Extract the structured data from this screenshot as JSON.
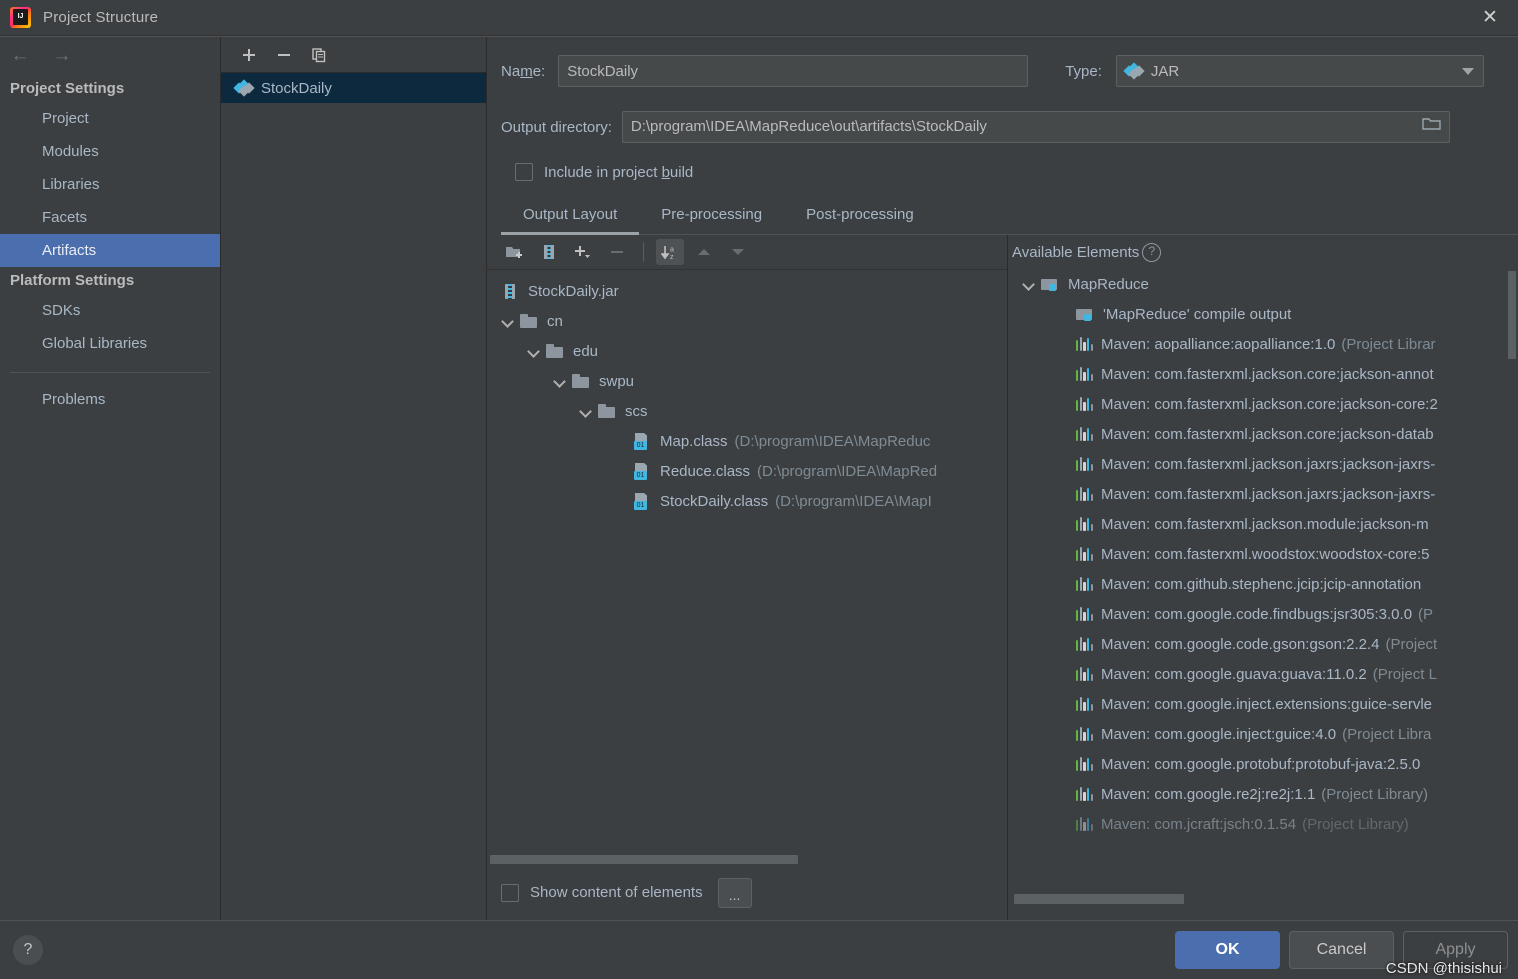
{
  "window": {
    "title": "Project Structure",
    "app_icon": "intellij-idea-logo",
    "close_label": "✕"
  },
  "sidebar": {
    "back_label": "←",
    "forward_label": "→",
    "groups": [
      {
        "title": "Project Settings",
        "items": [
          {
            "label": "Project",
            "selected": false
          },
          {
            "label": "Modules",
            "selected": false
          },
          {
            "label": "Libraries",
            "selected": false
          },
          {
            "label": "Facets",
            "selected": false
          },
          {
            "label": "Artifacts",
            "selected": true
          }
        ]
      },
      {
        "title": "Platform Settings",
        "items": [
          {
            "label": "SDKs",
            "selected": false
          },
          {
            "label": "Global Libraries",
            "selected": false
          }
        ]
      }
    ],
    "problems_label": "Problems"
  },
  "artifacts_panel": {
    "toolbar": [
      {
        "name": "add-artifact-button",
        "glyph": "+"
      },
      {
        "name": "remove-artifact-button",
        "glyph": "−"
      },
      {
        "name": "copy-artifact-button",
        "glyph": "⧉"
      }
    ],
    "items": [
      {
        "label": "StockDaily",
        "selected": true,
        "icon": "artifact-diamond-icon"
      }
    ]
  },
  "editor": {
    "name_label": "Na",
    "name_label_accel": "m",
    "name_label_rest": "e:",
    "name_value": "StockDaily",
    "type_label": "Type:",
    "type_value": "JAR",
    "output_dir_label": "Output directory:",
    "output_dir_value": "D:\\program\\IDEA\\MapReduce\\out\\artifacts\\StockDaily",
    "include_in_build_pre": "Include in project ",
    "include_in_build_accel": "b",
    "include_in_build_post": "uild",
    "include_in_build_checked": false,
    "tabs": [
      {
        "label": "Output Layout",
        "active": true
      },
      {
        "label": "Pre-processing",
        "active": false
      },
      {
        "label": "Post-processing",
        "active": false
      }
    ]
  },
  "output_layout": {
    "toolbar": [
      {
        "name": "add-directory-button",
        "glyph": "folder-plus-icon",
        "state": "enabled"
      },
      {
        "name": "add-archive-button",
        "glyph": "archive-icon",
        "state": "enabled"
      },
      {
        "name": "add-element-button",
        "glyph": "plus-dropdown-icon",
        "state": "enabled"
      },
      {
        "name": "remove-element-button",
        "glyph": "minus-icon",
        "state": "disabled"
      },
      {
        "name": "sort-alphabetically-button",
        "glyph": "sort-az-icon",
        "state": "toggled"
      },
      {
        "name": "move-up-button",
        "glyph": "arrow-up-icon",
        "state": "disabled"
      },
      {
        "name": "move-down-button",
        "glyph": "arrow-down-icon",
        "state": "disabled"
      }
    ],
    "tree": [
      {
        "label": "StockDaily.jar",
        "indent": 0,
        "icon": "jar",
        "chevron": false,
        "path": ""
      },
      {
        "label": "cn",
        "indent": 0,
        "icon": "folder",
        "chevron": true,
        "path": ""
      },
      {
        "label": "edu",
        "indent": 1,
        "icon": "folder",
        "chevron": true,
        "path": ""
      },
      {
        "label": "swpu",
        "indent": 2,
        "icon": "folder",
        "chevron": true,
        "path": ""
      },
      {
        "label": "scs",
        "indent": 3,
        "icon": "folder",
        "chevron": true,
        "path": ""
      },
      {
        "label": "Map.class",
        "indent": 4,
        "icon": "clazz",
        "chevron": false,
        "path": "(D:\\program\\IDEA\\MapReduc"
      },
      {
        "label": "Reduce.class",
        "indent": 4,
        "icon": "clazz",
        "chevron": false,
        "path": "(D:\\program\\IDEA\\MapRed"
      },
      {
        "label": "StockDaily.class",
        "indent": 4,
        "icon": "clazz",
        "chevron": false,
        "path": "(D:\\program\\IDEA\\MapI"
      }
    ],
    "show_content_label": "Show content of elements",
    "show_content_checked": false,
    "more_button_label": "..."
  },
  "available_elements": {
    "title": "Available Elements",
    "help_glyph": "?",
    "items": [
      {
        "label": "MapReduce",
        "indent": 0,
        "icon": "modfolder",
        "chevron": true,
        "sub": ""
      },
      {
        "label": "'MapReduce' compile output",
        "indent": 1,
        "icon": "modfolder",
        "chevron": false,
        "sub": ""
      },
      {
        "label": "Maven: aopalliance:aopalliance:1.0",
        "indent": 1,
        "icon": "library",
        "chevron": false,
        "sub": "(Project Librar"
      },
      {
        "label": "Maven: com.fasterxml.jackson.core:jackson-annot",
        "indent": 1,
        "icon": "library",
        "chevron": false,
        "sub": ""
      },
      {
        "label": "Maven: com.fasterxml.jackson.core:jackson-core:2",
        "indent": 1,
        "icon": "library",
        "chevron": false,
        "sub": ""
      },
      {
        "label": "Maven: com.fasterxml.jackson.core:jackson-datab",
        "indent": 1,
        "icon": "library",
        "chevron": false,
        "sub": ""
      },
      {
        "label": "Maven: com.fasterxml.jackson.jaxrs:jackson-jaxrs-",
        "indent": 1,
        "icon": "library",
        "chevron": false,
        "sub": ""
      },
      {
        "label": "Maven: com.fasterxml.jackson.jaxrs:jackson-jaxrs-",
        "indent": 1,
        "icon": "library",
        "chevron": false,
        "sub": ""
      },
      {
        "label": "Maven: com.fasterxml.jackson.module:jackson-m",
        "indent": 1,
        "icon": "library",
        "chevron": false,
        "sub": ""
      },
      {
        "label": "Maven: com.fasterxml.woodstox:woodstox-core:5",
        "indent": 1,
        "icon": "library",
        "chevron": false,
        "sub": ""
      },
      {
        "label": "Maven: com.github.stephenc.jcip:jcip-annotation",
        "indent": 1,
        "icon": "library",
        "chevron": false,
        "sub": ""
      },
      {
        "label": "Maven: com.google.code.findbugs:jsr305:3.0.0",
        "indent": 1,
        "icon": "library",
        "chevron": false,
        "sub": "(P"
      },
      {
        "label": "Maven: com.google.code.gson:gson:2.2.4",
        "indent": 1,
        "icon": "library",
        "chevron": false,
        "sub": "(Project"
      },
      {
        "label": "Maven: com.google.guava:guava:11.0.2",
        "indent": 1,
        "icon": "library",
        "chevron": false,
        "sub": "(Project L"
      },
      {
        "label": "Maven: com.google.inject.extensions:guice-servle",
        "indent": 1,
        "icon": "library",
        "chevron": false,
        "sub": ""
      },
      {
        "label": "Maven: com.google.inject:guice:4.0",
        "indent": 1,
        "icon": "library",
        "chevron": false,
        "sub": "(Project Libra"
      },
      {
        "label": "Maven: com.google.protobuf:protobuf-java:2.5.0",
        "indent": 1,
        "icon": "library",
        "chevron": false,
        "sub": ""
      },
      {
        "label": "Maven: com.google.re2j:re2j:1.1",
        "indent": 1,
        "icon": "library",
        "chevron": false,
        "sub": "(Project Library)"
      },
      {
        "label": "Maven: com.jcraft:jsch:0.1.54",
        "indent": 1,
        "icon": "library",
        "chevron": false,
        "sub": "(Project Library)"
      }
    ]
  },
  "footer": {
    "help_glyph": "?",
    "ok_label": "OK",
    "cancel_label": "Cancel",
    "apply_label": "Apply"
  },
  "watermark": "CSDN @thisishui",
  "colors": {
    "window_bg": "#3c3f41",
    "selection_blue": "#4b6eaf",
    "list_selection_navy": "#0d293e",
    "text": "#a9b7c6",
    "muted_text": "#7f8b94",
    "accent_cyan": "#40b6e0",
    "accent_green": "#62b543"
  }
}
